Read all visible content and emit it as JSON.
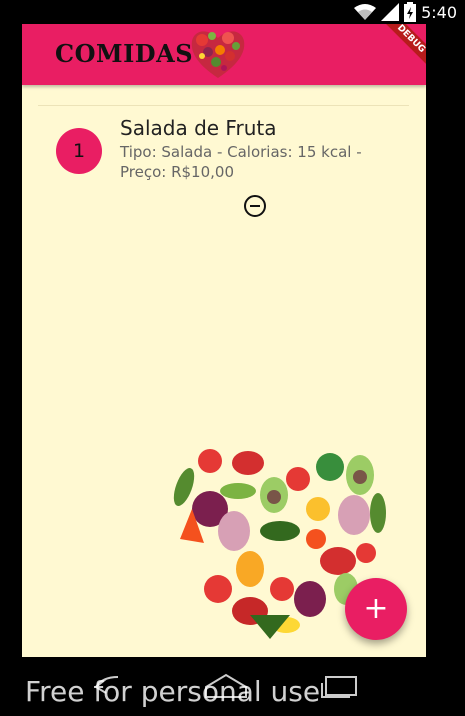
{
  "status_bar": {
    "time": "5:40"
  },
  "appbar": {
    "title": "COMIDAS",
    "debug_banner": "DEBUG"
  },
  "foods": [
    {
      "index": "1",
      "name": "Salada de Fruta",
      "details": " Tipo: Salada - Calorias: 15 kcal - Preço: R$10,00"
    }
  ],
  "fab": {
    "label": "+"
  },
  "watermark": "Free for personal use",
  "colors": {
    "primary": "#e91e63",
    "background": "#fff9d2",
    "frame": "#000000"
  },
  "icons": [
    "wifi-icon",
    "signal-icon",
    "battery-icon",
    "remove-circle-icon",
    "add-icon",
    "back-icon",
    "home-icon",
    "recents-icon"
  ]
}
